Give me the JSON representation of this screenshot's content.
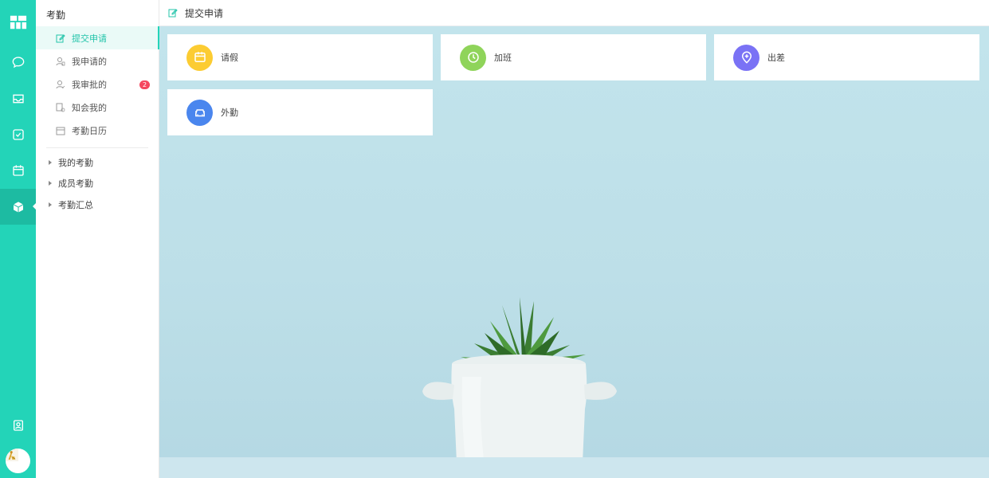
{
  "rail": {
    "items": [
      "logo-icon",
      "chat-icon",
      "inbox-icon",
      "task-icon",
      "calendar-icon",
      "attendance-icon"
    ],
    "active": "attendance-icon",
    "bottom": [
      "contacts-icon"
    ]
  },
  "sidebar": {
    "title": "考勤",
    "items": [
      {
        "label": "提交申请",
        "icon": "edit-icon",
        "active": true
      },
      {
        "label": "我申请的",
        "icon": "user-icon"
      },
      {
        "label": "我审批的",
        "icon": "user-check-icon",
        "badge": "2"
      },
      {
        "label": "知会我的",
        "icon": "notify-icon"
      },
      {
        "label": "考勤日历",
        "icon": "calendar-icon"
      }
    ],
    "groups": [
      {
        "label": "我的考勤"
      },
      {
        "label": "成员考勤"
      },
      {
        "label": "考勤汇总"
      }
    ]
  },
  "header": {
    "title": "提交申请"
  },
  "cards": [
    {
      "label": "请假",
      "icon": "calendar-icon",
      "color": "#fccc32"
    },
    {
      "label": "加班",
      "icon": "clock-icon",
      "color": "#8fd45a"
    },
    {
      "label": "出差",
      "icon": "location-icon",
      "color": "#7a72f5"
    },
    {
      "label": "外勤",
      "icon": "car-icon",
      "color": "#4a86ee"
    }
  ],
  "colors": {
    "accent": "#23d4b8",
    "badge": "#f5475f"
  }
}
